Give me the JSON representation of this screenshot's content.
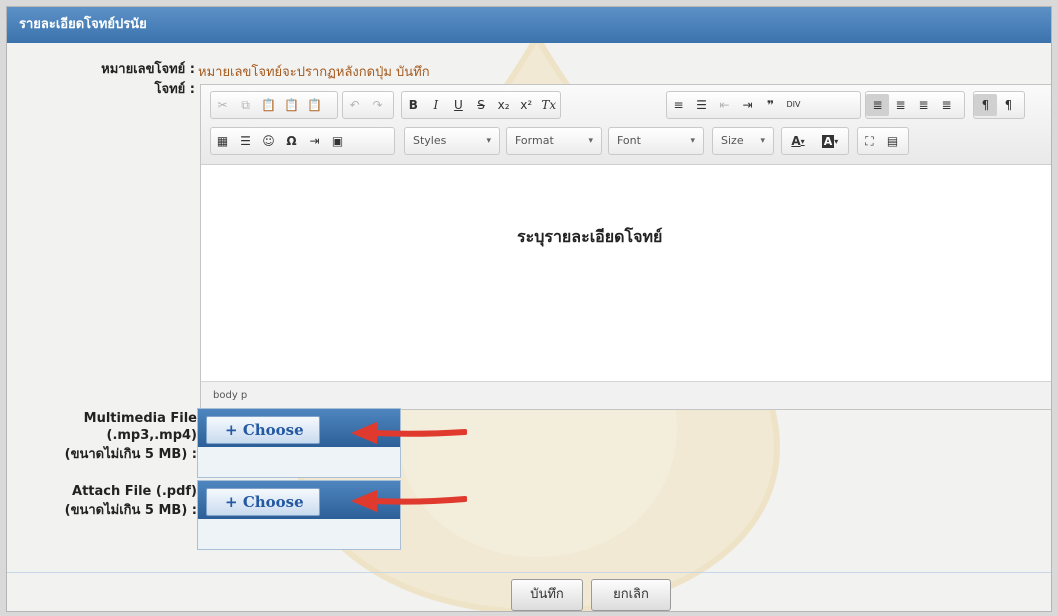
{
  "panel": {
    "title": "รายละเอียดโจทย์ปรนัย"
  },
  "form": {
    "number_label": "หมายเลขโจทย์ :",
    "number_value": "หมายเลขโจทย์จะปรากฏหลังกดปุ่ม บันทึก",
    "question_label": "โจทย์ :",
    "multimedia_label": [
      "Multimedia File",
      "(.mp3,.mp4)",
      "(ขนาดไม่เกิน 5 MB) :"
    ],
    "attach_label": [
      "Attach File (.pdf)",
      "(ขนาดไม่เกิน 5 MB) :"
    ]
  },
  "editor": {
    "toolbar_row1": {
      "clipboard": [
        "cut-icon",
        "copy-icon",
        "paste-icon",
        "paste-text-icon",
        "paste-word-icon"
      ],
      "history": [
        "undo-icon",
        "redo-icon"
      ],
      "basicstyles": [
        "B",
        "I",
        "U",
        "S",
        "x₂",
        "x²",
        "Tx"
      ],
      "list": [
        "numbered-list-icon",
        "bulleted-list-icon",
        "outdent-icon",
        "indent-icon",
        "blockquote-icon",
        "div-icon"
      ],
      "align": [
        "align-left-icon",
        "align-center-icon",
        "align-right-icon",
        "justify-icon"
      ],
      "bidi": [
        "ltr-icon",
        "rtl-icon"
      ]
    },
    "toolbar_row2": {
      "insert": [
        "table-icon",
        "horizontal-rule-icon",
        "smiley-icon",
        "Ω",
        "page-break-icon",
        "image-icon"
      ],
      "styles": "Styles",
      "format": "Format",
      "font": "Font",
      "size": "Size",
      "text_color": "A",
      "bg_color": "A",
      "tools": [
        "maximize-icon",
        "show-blocks-icon"
      ]
    },
    "content": "ระบุรายละเอียดโจทย์",
    "path": "body  p"
  },
  "upload": {
    "choose_label": "Choose",
    "plus": "+"
  },
  "buttons": {
    "save": "บันทึก",
    "cancel": "ยกเลิก"
  },
  "colors": {
    "header": "#3c73ad",
    "value_text": "#a55a1e",
    "arrow": "#e03a2e",
    "choose_text": "#2458a0"
  }
}
